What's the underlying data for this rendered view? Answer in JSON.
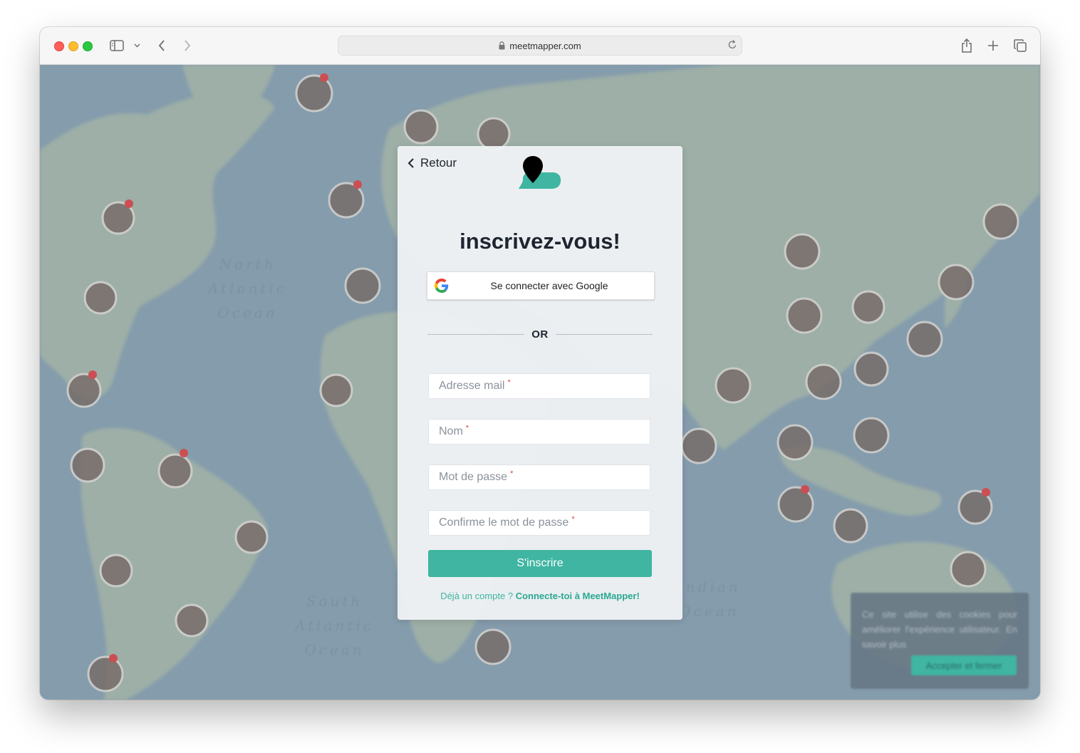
{
  "browser": {
    "url": "meetmapper.com"
  },
  "map": {
    "ocean_labels": [
      {
        "id": "north-atlantic",
        "text": "North\nAtlantic\nOcean"
      },
      {
        "id": "south-atlantic",
        "text": "South\nAtlantic\nOcean"
      },
      {
        "id": "indian",
        "text": "Indian\nOcean"
      }
    ]
  },
  "modal": {
    "back_label": "Retour",
    "title": "inscrivez-vous!",
    "google_label": "Se connecter avec Google",
    "divider_label": "OR",
    "fields": {
      "email": "Adresse mail",
      "name": "Nom",
      "password": "Mot de passe",
      "confirm": "Confirme le mot de passe"
    },
    "required_mark": "*",
    "submit_label": "S'inscrire",
    "login_prompt": "Déjà un compte ?",
    "login_link": "Connecte-toi à MeetMapper!"
  },
  "cookie_banner": {
    "text": "Ce site utilise des cookies pour améliorer l'expérience utilisateur. En savoir plus",
    "accept_label": "Accepter et fermer"
  },
  "colors": {
    "accent": "#3fb5a2",
    "ocean": "#8aa3b3",
    "land": "#a7b9ab",
    "required": "#e04545"
  }
}
